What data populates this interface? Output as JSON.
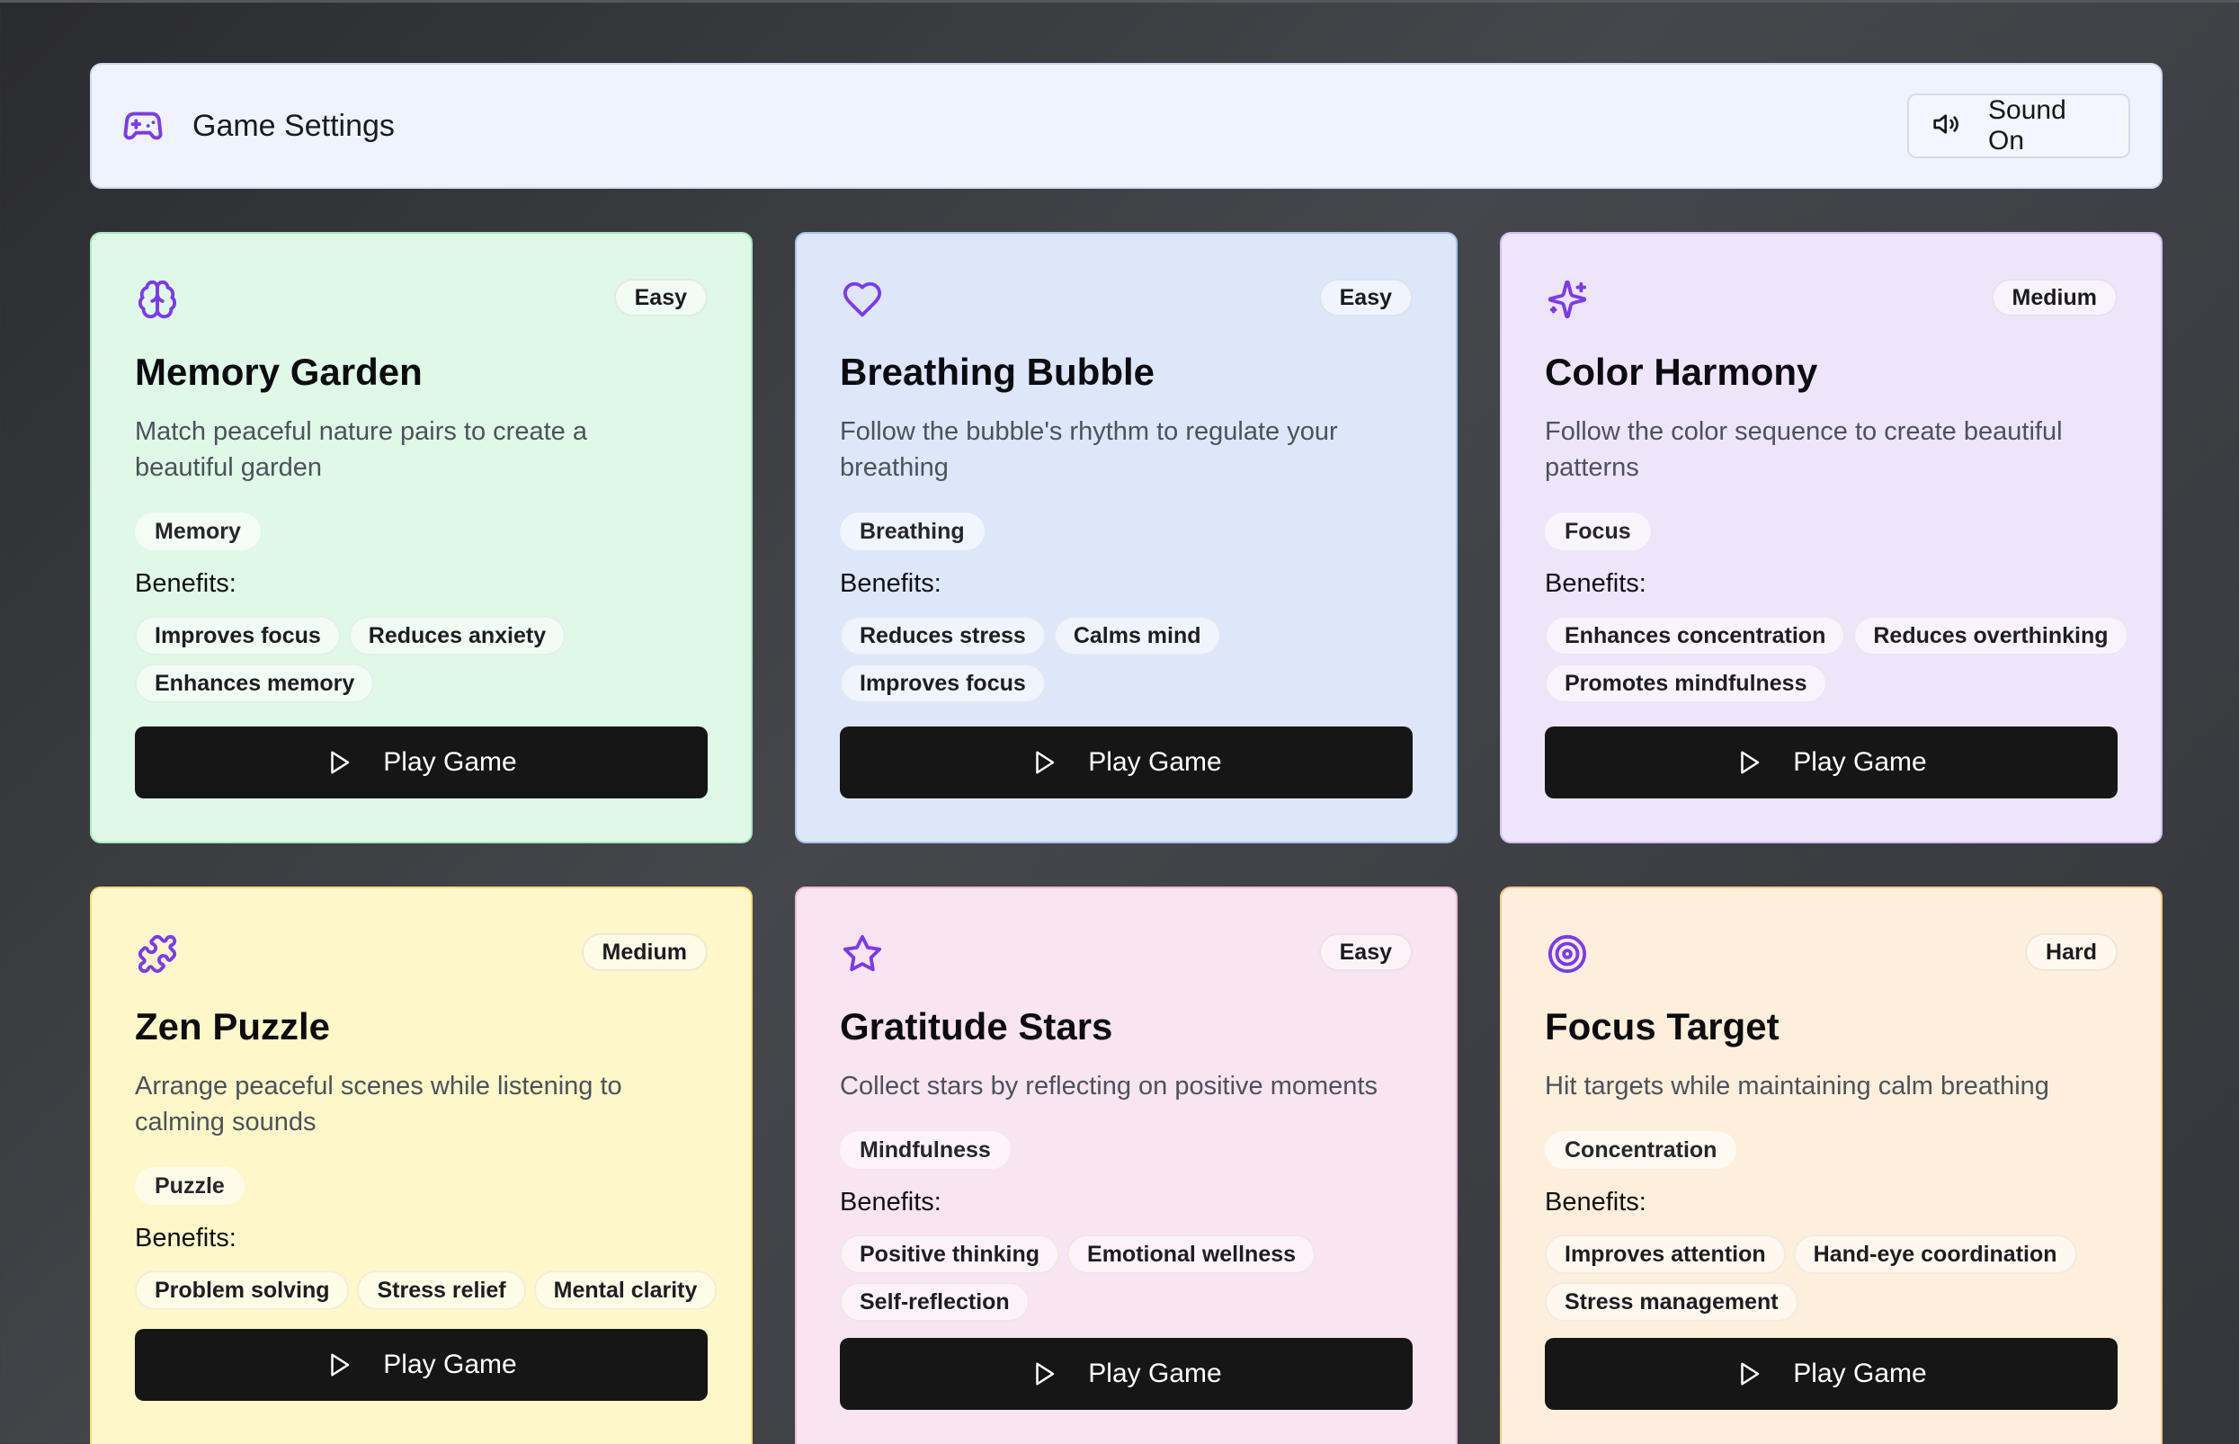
{
  "colors": {
    "icon_accent": "#7c3aed",
    "button_bg": "#161616",
    "header_bg": "#eef3fd"
  },
  "header": {
    "icon": "gamepad-icon",
    "title": "Game Settings",
    "sound_button": {
      "icon": "volume-icon",
      "label": "Sound On"
    }
  },
  "games": [
    {
      "icon": "brain-icon",
      "difficulty": "Easy",
      "title": "Memory Garden",
      "description": "Match peaceful nature pairs to create a beautiful garden",
      "category": "Memory",
      "benefits_label": "Benefits:",
      "benefits": [
        "Improves focus",
        "Reduces anxiety",
        "Enhances memory"
      ],
      "play_label": "Play Game",
      "color": "#e0f8e7"
    },
    {
      "icon": "heart-icon",
      "difficulty": "Easy",
      "title": "Breathing Bubble",
      "description": "Follow the bubble's rhythm to regulate your breathing",
      "category": "Breathing",
      "benefits_label": "Benefits:",
      "benefits": [
        "Reduces stress",
        "Calms mind",
        "Improves focus"
      ],
      "play_label": "Play Game",
      "color": "#dde7f9"
    },
    {
      "icon": "sparkles-icon",
      "difficulty": "Medium",
      "title": "Color Harmony",
      "description": "Follow the color sequence to create beautiful patterns",
      "category": "Focus",
      "benefits_label": "Benefits:",
      "benefits": [
        "Enhances concentration",
        "Reduces overthinking",
        "Promotes mindfulness"
      ],
      "play_label": "Play Game",
      "color": "#efe5fb"
    },
    {
      "icon": "puzzle-icon",
      "difficulty": "Medium",
      "title": "Zen Puzzle",
      "description": "Arrange peaceful scenes while listening to calming sounds",
      "category": "Puzzle",
      "benefits_label": "Benefits:",
      "benefits": [
        "Problem solving",
        "Stress relief",
        "Mental clarity"
      ],
      "play_label": "Play Game",
      "color": "#fdf7c9"
    },
    {
      "icon": "star-icon",
      "difficulty": "Easy",
      "title": "Gratitude Stars",
      "description": "Collect stars by reflecting on positive moments",
      "category": "Mindfulness",
      "benefits_label": "Benefits:",
      "benefits": [
        "Positive thinking",
        "Emotional wellness",
        "Self-reflection"
      ],
      "play_label": "Play Game",
      "color": "#f9e4f1"
    },
    {
      "icon": "target-icon",
      "difficulty": "Hard",
      "title": "Focus Target",
      "description": "Hit targets while maintaining calm breathing",
      "category": "Concentration",
      "benefits_label": "Benefits:",
      "benefits": [
        "Improves attention",
        "Hand-eye coordination",
        "Stress management"
      ],
      "play_label": "Play Game",
      "color": "#fdefdb"
    }
  ]
}
